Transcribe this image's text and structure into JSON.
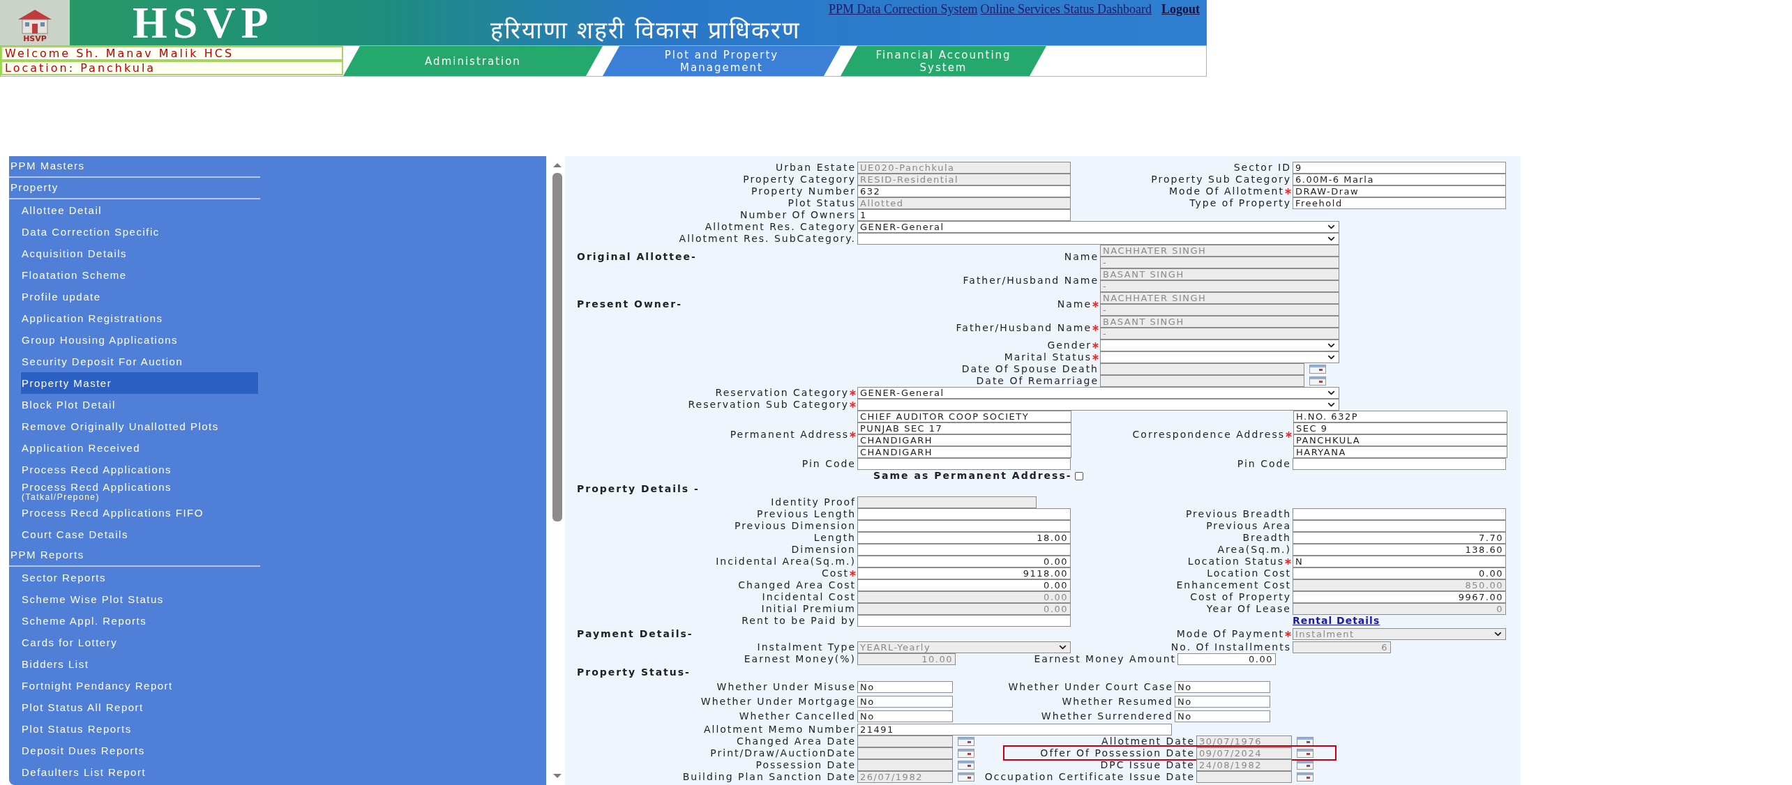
{
  "header": {
    "logo_caption": "HSVP",
    "title": "HSVP",
    "links": [
      {
        "label": "PPM Data Correction System"
      },
      {
        "label": "Online Services Status Dashboard"
      }
    ],
    "logout": "Logout",
    "hindi_title": "हरियाणा शहरी विकास प्राधिकरण",
    "welcome": "Welcome Sh. Manav Malik HCS",
    "location": "Location: Panchkula",
    "nav": [
      {
        "label": "Administration",
        "selected": false
      },
      {
        "label": "Plot and Property Management",
        "selected": true
      },
      {
        "label": "Financial Accounting System",
        "selected": false
      }
    ]
  },
  "sidebar": {
    "sections": [
      {
        "title": "PPM Masters"
      },
      {
        "title": "Property",
        "items": [
          {
            "label": "Allottee Detail",
            "selected": false
          },
          {
            "label": "Data Correction Specific",
            "selected": false
          },
          {
            "label": "Acquisition Details",
            "selected": false
          },
          {
            "label": "Floatation Scheme",
            "selected": false
          },
          {
            "label": "Profile update",
            "selected": false
          },
          {
            "label": "Application Registrations",
            "selected": false
          },
          {
            "label": "Group Housing Applications",
            "selected": false
          },
          {
            "label": "Security Deposit For Auction",
            "selected": false
          },
          {
            "label": "Property Master",
            "selected": true
          },
          {
            "label": "Block Plot Detail",
            "selected": false
          },
          {
            "label": "Remove Originally Unallotted Plots",
            "selected": false
          },
          {
            "label": "Application Received",
            "selected": false
          },
          {
            "label": "Process Recd Applications",
            "selected": false
          },
          {
            "label": "Process Recd Applications",
            "note": "(Tatkal/Prepone)",
            "selected": false
          },
          {
            "label": "Process Recd Applications FIFO",
            "selected": false
          },
          {
            "label": "Court Case Details",
            "selected": false
          }
        ]
      },
      {
        "title": "PPM Reports",
        "items": [
          {
            "label": "Sector Reports",
            "selected": false
          },
          {
            "label": "Scheme Wise Plot Status",
            "selected": false
          },
          {
            "label": "Scheme Appl. Reports",
            "selected": false
          },
          {
            "label": "Cards for Lottery",
            "selected": false
          },
          {
            "label": "Bidders List",
            "selected": false
          },
          {
            "label": "Fortnight Pendancy Report",
            "selected": false
          },
          {
            "label": "Plot Status All Report",
            "selected": false
          },
          {
            "label": "Plot Status Reports",
            "selected": false
          },
          {
            "label": "Deposit Dues Reports",
            "selected": false
          },
          {
            "label": "Defaulters List Report",
            "selected": false
          }
        ]
      }
    ]
  },
  "form": {
    "rows": [
      {
        "left": {
          "kind": "text",
          "label": "Urban Estate",
          "value": "UE020-Panchkula",
          "required": false,
          "disabled": true
        },
        "right": {
          "kind": "text",
          "label": "Sector ID",
          "value": "9",
          "required": false,
          "disabled": false
        }
      },
      {
        "left": {
          "kind": "text",
          "label": "Property Category",
          "value": "RESID-Residential",
          "required": false,
          "disabled": true
        },
        "right": {
          "kind": "text",
          "label": "Property Sub Category",
          "value": "6.00M-6 Marla",
          "required": false,
          "disabled": false
        }
      },
      {
        "left": {
          "kind": "text",
          "label": "Property Number",
          "value": "632",
          "required": false,
          "disabled": false
        },
        "right": {
          "kind": "text",
          "label": "Mode Of Allotment",
          "value": "DRAW-Draw",
          "required": true,
          "disabled": false
        }
      },
      {
        "left": {
          "kind": "text",
          "label": "Plot Status",
          "value": "Allotted",
          "required": false,
          "disabled": true
        },
        "right": {
          "kind": "text",
          "label": "Type of Property",
          "value": "Freehold",
          "required": false,
          "disabled": false
        }
      },
      {
        "left": {
          "kind": "text",
          "label": "Number Of Owners",
          "value": "1",
          "required": false,
          "disabled": false
        }
      },
      {
        "left": {
          "kind": "wide_select",
          "label": "Allotment Res. Category",
          "value": "GENER-General",
          "required": false,
          "disabled": false
        }
      },
      {
        "left": {
          "kind": "wide_select",
          "label": "Allotment Res. SubCategory.",
          "required": false,
          "disabled": false
        }
      },
      {
        "heading": "Original Allottee-",
        "left": {
          "kind": "name",
          "label": "Name",
          "lines": [
            "NACHHATER SINGH",
            "-"
          ],
          "required": false,
          "disabled": true
        }
      },
      {
        "left": {
          "kind": "name",
          "label": "Father/Husband Name",
          "lines": [
            "BASANT SINGH",
            "-"
          ],
          "required": false,
          "disabled": true
        }
      },
      {
        "heading": "Present Owner-",
        "left": {
          "kind": "name",
          "label": "Name",
          "lines": [
            "NACHHATER SINGH",
            "-"
          ],
          "required": true,
          "disabled": true
        }
      },
      {
        "left": {
          "kind": "name",
          "label": "Father/Husband Name",
          "lines": [
            "BASANT SINGH",
            "-"
          ],
          "required": true,
          "disabled": true
        }
      },
      {
        "left": {
          "kind": "owner_select",
          "label": "Gender",
          "required": true,
          "disabled": false
        }
      },
      {
        "left": {
          "kind": "owner_select",
          "label": "Marital Status",
          "required": true,
          "disabled": false
        }
      },
      {
        "left": {
          "kind": "owner_date",
          "label": "Date Of Spouse Death",
          "required": false,
          "disabled": true
        }
      },
      {
        "left": {
          "kind": "owner_date",
          "label": "Date Of Remarriage",
          "required": false,
          "disabled": true
        }
      },
      {
        "left": {
          "kind": "wide_select",
          "label": "Reservation Category",
          "value": "GENER-General",
          "required": true,
          "disabled": false
        }
      },
      {
        "left": {
          "kind": "wide_select",
          "label": "Reservation Sub Category",
          "required": true,
          "disabled": false
        }
      },
      {
        "left": {
          "kind": "address",
          "label": "Permanent Address",
          "lines": [
            "CHIEF AUDITOR COOP SOCIETY",
            "PUNJAB SEC 17",
            "CHANDIGARH",
            "CHANDIGARH"
          ],
          "required": true,
          "disabled": false
        },
        "right": {
          "kind": "address",
          "label": "Correspondence Address",
          "lines": [
            "H.NO. 632P",
            "SEC 9",
            "PANCHKULA",
            "HARYANA"
          ],
          "required": true,
          "disabled": false
        }
      },
      {
        "left": {
          "kind": "text",
          "label": "Pin Code",
          "required": false,
          "disabled": false
        },
        "right": {
          "kind": "text",
          "label": "Pin Code",
          "required": false,
          "disabled": false
        }
      },
      {
        "checkbox": {
          "label": "Same as Permanent Address-",
          "checked": false
        }
      },
      {
        "heading": "Property Details -"
      },
      {
        "left": {
          "kind": "medium",
          "label": "Identity Proof",
          "required": false,
          "disabled": true
        }
      },
      {
        "left": {
          "kind": "number",
          "label": "Previous Length",
          "required": false,
          "disabled": false
        },
        "right": {
          "kind": "number",
          "label": "Previous Breadth",
          "required": false,
          "disabled": false
        }
      },
      {
        "left": {
          "kind": "number",
          "label": "Previous Dimension",
          "required": false,
          "disabled": false
        },
        "right": {
          "kind": "number",
          "label": "Previous Area",
          "required": false,
          "disabled": false
        }
      },
      {
        "left": {
          "kind": "number",
          "label": "Length",
          "value": "18.00",
          "required": false,
          "disabled": false
        },
        "right": {
          "kind": "number",
          "label": "Breadth",
          "value": "7.70",
          "required": false,
          "disabled": false
        }
      },
      {
        "left": {
          "kind": "number",
          "label": "Dimension",
          "required": false,
          "disabled": false
        },
        "right": {
          "kind": "number",
          "label": "Area(Sq.m.)",
          "value": "138.60",
          "required": false,
          "disabled": false
        }
      },
      {
        "left": {
          "kind": "number",
          "label": "Incidental Area(Sq.m.)",
          "value": "0.00",
          "required": false,
          "disabled": false
        },
        "right": {
          "kind": "text",
          "label": "Location Status",
          "value": "N",
          "required": true,
          "disabled": false
        }
      },
      {
        "left": {
          "kind": "number",
          "label": "Cost",
          "value": "9118.00",
          "required": true,
          "disabled": false
        },
        "right": {
          "kind": "number",
          "label": "Location Cost",
          "value": "0.00",
          "required": false,
          "disabled": false
        }
      },
      {
        "left": {
          "kind": "number",
          "label": "Changed Area Cost",
          "value": "0.00",
          "required": false,
          "disabled": false
        },
        "right": {
          "kind": "number",
          "label": "Enhancement Cost",
          "value": "850.00",
          "required": false,
          "disabled": true
        }
      },
      {
        "left": {
          "kind": "number",
          "label": "Incidental Cost",
          "value": "0.00",
          "required": false,
          "disabled": true
        },
        "right": {
          "kind": "number",
          "label": "Cost of Property",
          "value": "9967.00",
          "required": false,
          "disabled": false
        }
      },
      {
        "left": {
          "kind": "number",
          "label": "Initial Premium",
          "value": "0.00",
          "required": false,
          "disabled": true
        },
        "right": {
          "kind": "number",
          "label": "Year Of Lease",
          "value": "0",
          "required": false,
          "disabled": true
        }
      },
      {
        "left": {
          "kind": "text",
          "label": "Rent to be Paid by",
          "required": false,
          "disabled": false
        },
        "right": {
          "kind": "link",
          "label": "Rental Details"
        }
      },
      {
        "heading": "Payment Details-",
        "right": {
          "kind": "select",
          "label": "Mode Of Payment",
          "value": "Instalment",
          "required": true,
          "disabled": true
        }
      },
      {
        "left": {
          "kind": "select",
          "label": "Instalment Type",
          "value": "YEARL-Yearly",
          "required": false,
          "disabled": true
        },
        "right": {
          "kind": "narrow_number",
          "label": "No. Of Installments",
          "value": "6",
          "required": false,
          "disabled": true
        }
      },
      {
        "left": {
          "kind": "narrow_number",
          "label": "Earnest Money(%)",
          "value": "10.00",
          "required": false,
          "disabled": true
        },
        "right": {
          "kind": "narrow_number",
          "label": "Earnest Money Amount",
          "value": "0.00",
          "required": false,
          "disabled": false
        }
      },
      {
        "heading": "Property Status-"
      },
      {
        "left": {
          "kind": "short",
          "label": "Whether Under Misuse",
          "value": "No",
          "required": false,
          "disabled": false
        },
        "right": {
          "kind": "short",
          "label": "Whether Under Court Case",
          "value": "No",
          "required": false,
          "disabled": false
        }
      },
      {
        "left": {
          "kind": "short",
          "label": "Whether Under Mortgage",
          "value": "No",
          "required": false,
          "disabled": false
        },
        "right": {
          "kind": "short",
          "label": "Whether Resumed",
          "value": "No",
          "required": false,
          "disabled": false
        }
      },
      {
        "left": {
          "kind": "short",
          "label": "Whether Cancelled",
          "value": "No",
          "required": false,
          "disabled": false
        },
        "right": {
          "kind": "short",
          "label": "Whether Surrendered",
          "value": "No",
          "required": false,
          "disabled": false
        }
      },
      {
        "left": {
          "kind": "wide",
          "label": "Allotment Memo Number",
          "value": "21491",
          "required": false,
          "disabled": false
        }
      },
      {
        "left": {
          "kind": "date",
          "label": "Changed Area Date",
          "required": false,
          "disabled": true
        },
        "right": {
          "kind": "date",
          "label": "Allotment Date",
          "value": "30/07/1976",
          "required": false,
          "disabled": true,
          "highlighted": false
        }
      },
      {
        "left": {
          "kind": "date",
          "label": "Print/Draw/AuctionDate",
          "required": false,
          "disabled": true
        },
        "right": {
          "kind": "date",
          "label": "Offer Of Possession Date",
          "value": "09/07/2024",
          "required": false,
          "disabled": true,
          "highlighted": true
        }
      },
      {
        "left": {
          "kind": "date",
          "label": "Possession Date",
          "required": false,
          "disabled": true
        },
        "right": {
          "kind": "date",
          "label": "DPC Issue Date",
          "value": "24/08/1982",
          "required": false,
          "disabled": true,
          "highlighted": false
        }
      },
      {
        "left": {
          "kind": "date",
          "label": "Building Plan Sanction Date",
          "value": "26/07/1982",
          "required": false,
          "disabled": true
        },
        "right": {
          "kind": "date",
          "label": "Occupation Certificate Issue Date",
          "required": false,
          "disabled": true,
          "highlighted": false
        }
      }
    ]
  }
}
